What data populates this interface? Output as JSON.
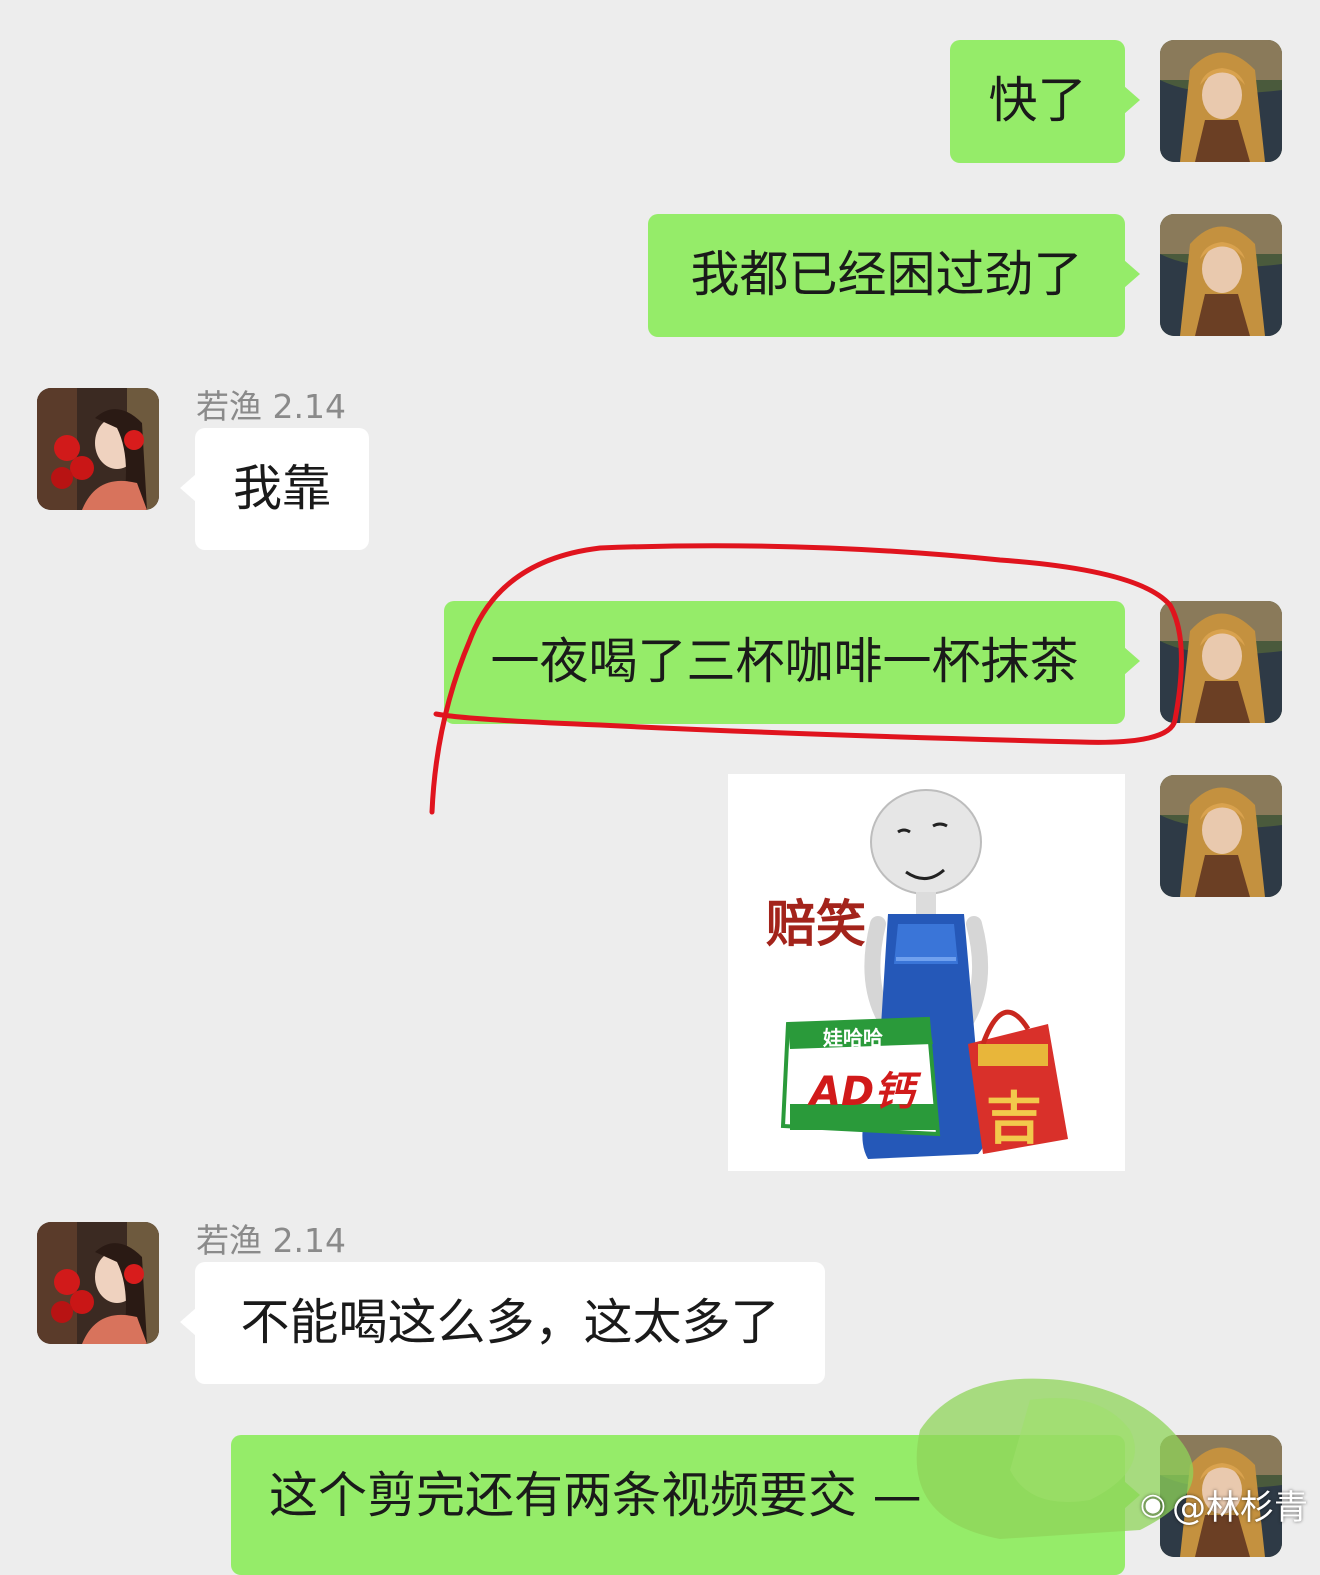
{
  "messages": [
    {
      "text": "快了"
    },
    {
      "text": "我都已经困过劲了"
    },
    {
      "sender": "若渔 2.14",
      "text": "我靠"
    },
    {
      "text": "一夜喝了三杯咖啡一杯抹茶"
    },
    {
      "sticker_caption": "赔笑",
      "sticker_box_brand": "娃哈哈",
      "sticker_box_label": "AD钙",
      "sticker_bag_label": "吉"
    },
    {
      "sender": "若渔 2.14",
      "text": "不能喝这么多，这太多了"
    },
    {
      "text": "这个剪完还有两条视频要交 —"
    }
  ],
  "watermark": {
    "logo": "weibo-logo-icon",
    "text": "@林杉青"
  },
  "colors": {
    "background": "#ededed",
    "mine_bubble": "#95ec69",
    "theirs_bubble": "#ffffff",
    "annotation": "#e0141e"
  }
}
